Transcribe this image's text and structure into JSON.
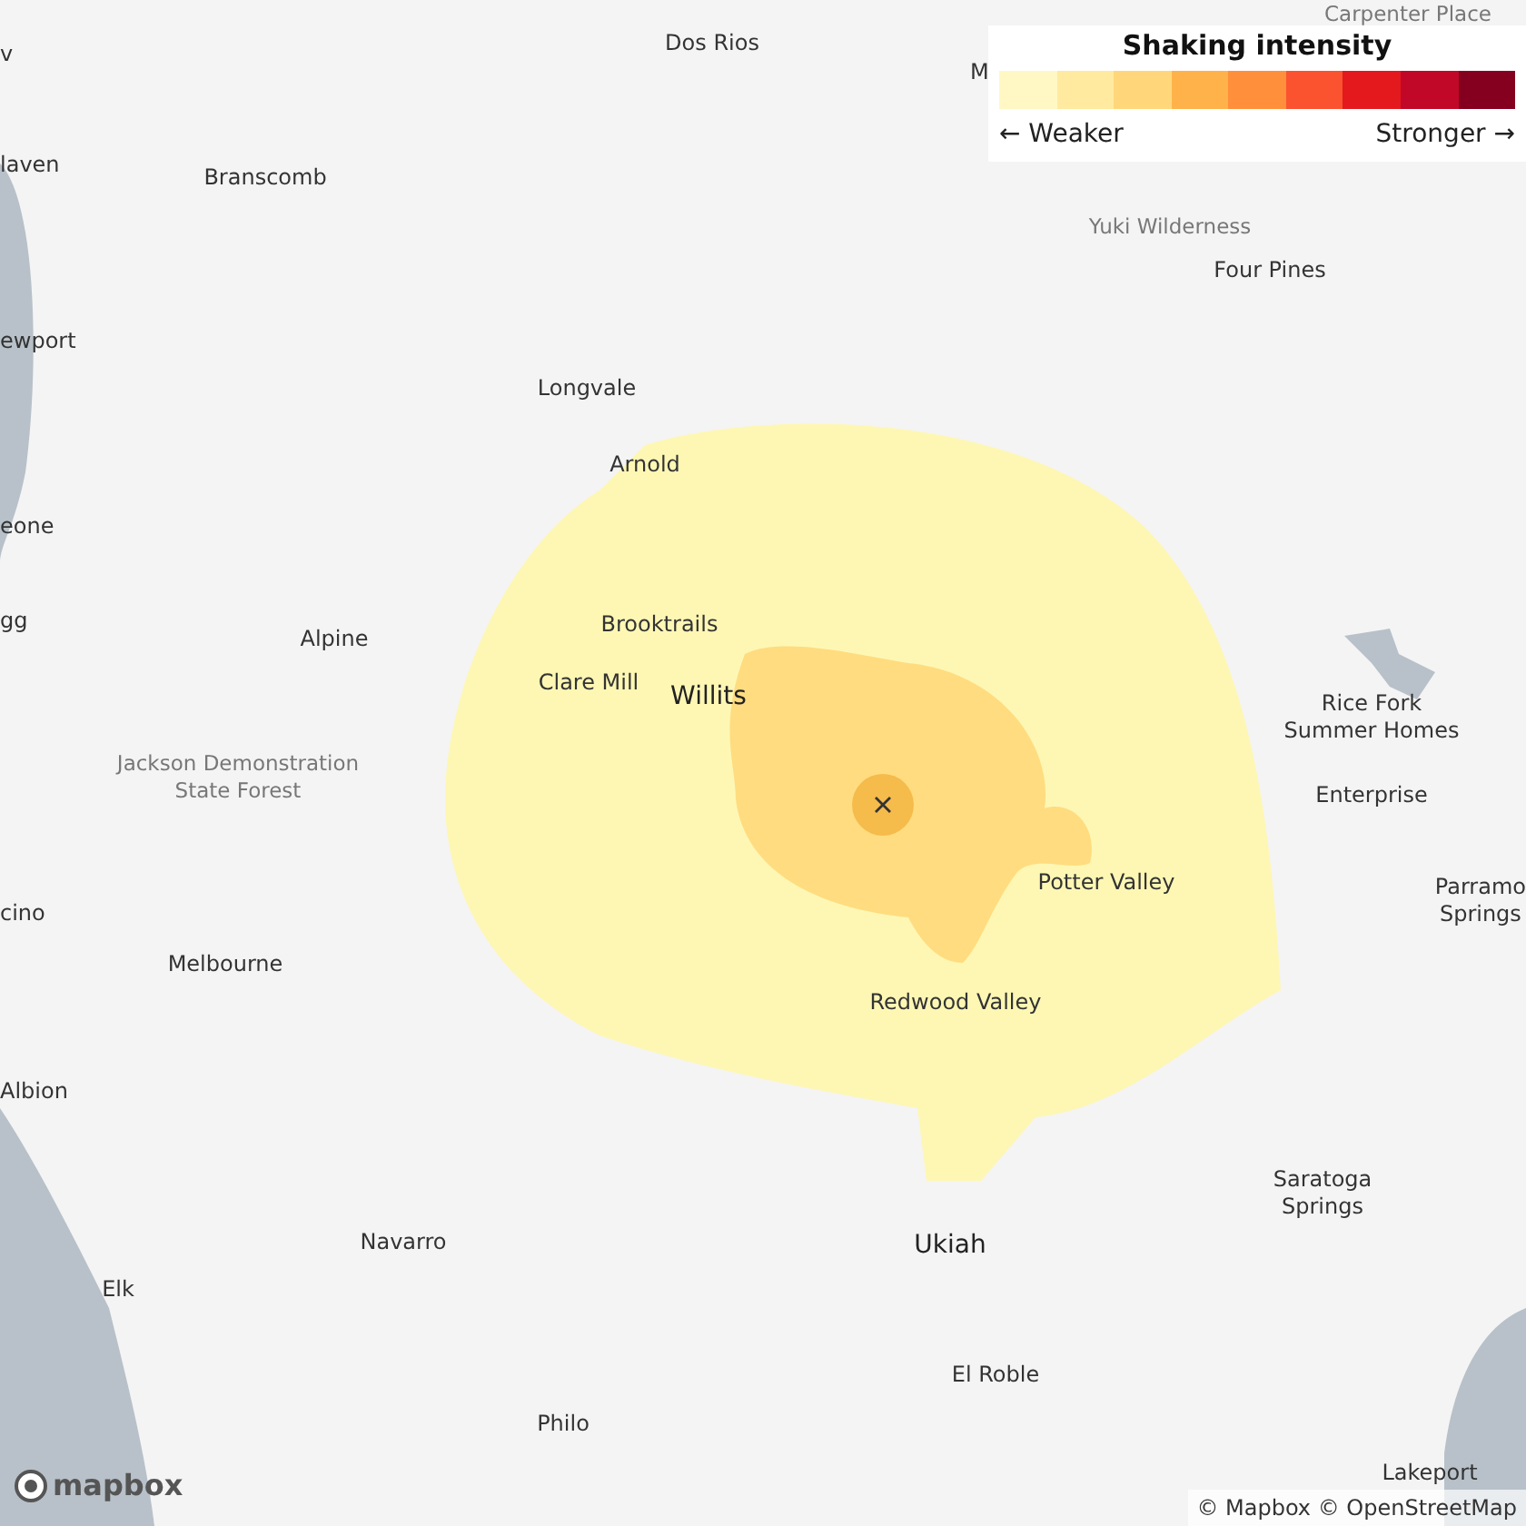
{
  "legend": {
    "title": "Shaking intensity",
    "colors": [
      {
        "color": "#fff8c4"
      },
      {
        "color": "#ffeaa0"
      },
      {
        "color": "#ffd77a"
      },
      {
        "color": "#ffb24a"
      },
      {
        "color": "#ff8f3a"
      },
      {
        "color": "#fb5230"
      },
      {
        "color": "#e3191e"
      },
      {
        "color": "#c20828"
      },
      {
        "color": "#85001f"
      }
    ],
    "weaker": "← Weaker",
    "stronger": "Stronger →"
  },
  "labels": [
    {
      "lines": [
        "v"
      ],
      "kind": "town"
    },
    {
      "lines": [
        "Dos Rios"
      ],
      "kind": "town"
    },
    {
      "lines": [
        "M"
      ],
      "kind": "town"
    },
    {
      "lines": [
        "Carpenter Place"
      ],
      "kind": "area"
    },
    {
      "lines": [
        "laven"
      ],
      "kind": "town"
    },
    {
      "lines": [
        "Branscomb"
      ],
      "kind": "town"
    },
    {
      "lines": [
        "ewport"
      ],
      "kind": "town"
    },
    {
      "lines": [
        "Yuki Wilderness"
      ],
      "kind": "area"
    },
    {
      "lines": [
        "Four Pines"
      ],
      "kind": "town"
    },
    {
      "lines": [
        "Longvale"
      ],
      "kind": "town"
    },
    {
      "lines": [
        "Arnold"
      ],
      "kind": "town"
    },
    {
      "lines": [
        "eone"
      ],
      "kind": "town"
    },
    {
      "lines": [
        "gg"
      ],
      "kind": "town"
    },
    {
      "lines": [
        "Alpine"
      ],
      "kind": "town"
    },
    {
      "lines": [
        "Brooktrails"
      ],
      "kind": "town"
    },
    {
      "lines": [
        "Clare Mill"
      ],
      "kind": "town"
    },
    {
      "lines": [
        "Willits"
      ],
      "kind": "city"
    },
    {
      "lines": [
        "Rice Fork",
        "Summer Homes"
      ],
      "kind": "town"
    },
    {
      "lines": [
        "Jackson Demonstration",
        "State Forest"
      ],
      "kind": "area"
    },
    {
      "lines": [
        "Enterprise"
      ],
      "kind": "town"
    },
    {
      "lines": [
        "Potter Valley"
      ],
      "kind": "town"
    },
    {
      "lines": [
        "cino"
      ],
      "kind": "town"
    },
    {
      "lines": [
        "Parramo",
        "Springs"
      ],
      "kind": "town"
    },
    {
      "lines": [
        "Melbourne"
      ],
      "kind": "town"
    },
    {
      "lines": [
        "Redwood Valley"
      ],
      "kind": "town"
    },
    {
      "lines": [
        "Albion"
      ],
      "kind": "town"
    },
    {
      "lines": [
        "Saratoga",
        "Springs"
      ],
      "kind": "town"
    },
    {
      "lines": [
        "Navarro"
      ],
      "kind": "town"
    },
    {
      "lines": [
        "Ukiah"
      ],
      "kind": "city"
    },
    {
      "lines": [
        "Elk"
      ],
      "kind": "town"
    },
    {
      "lines": [
        "El Roble"
      ],
      "kind": "town"
    },
    {
      "lines": [
        "Philo"
      ],
      "kind": "town"
    },
    {
      "lines": [
        "Lakeport"
      ],
      "kind": "town"
    }
  ],
  "logo": {
    "text": "mapbox"
  },
  "attribution": "© Mapbox © OpenStreetMap"
}
